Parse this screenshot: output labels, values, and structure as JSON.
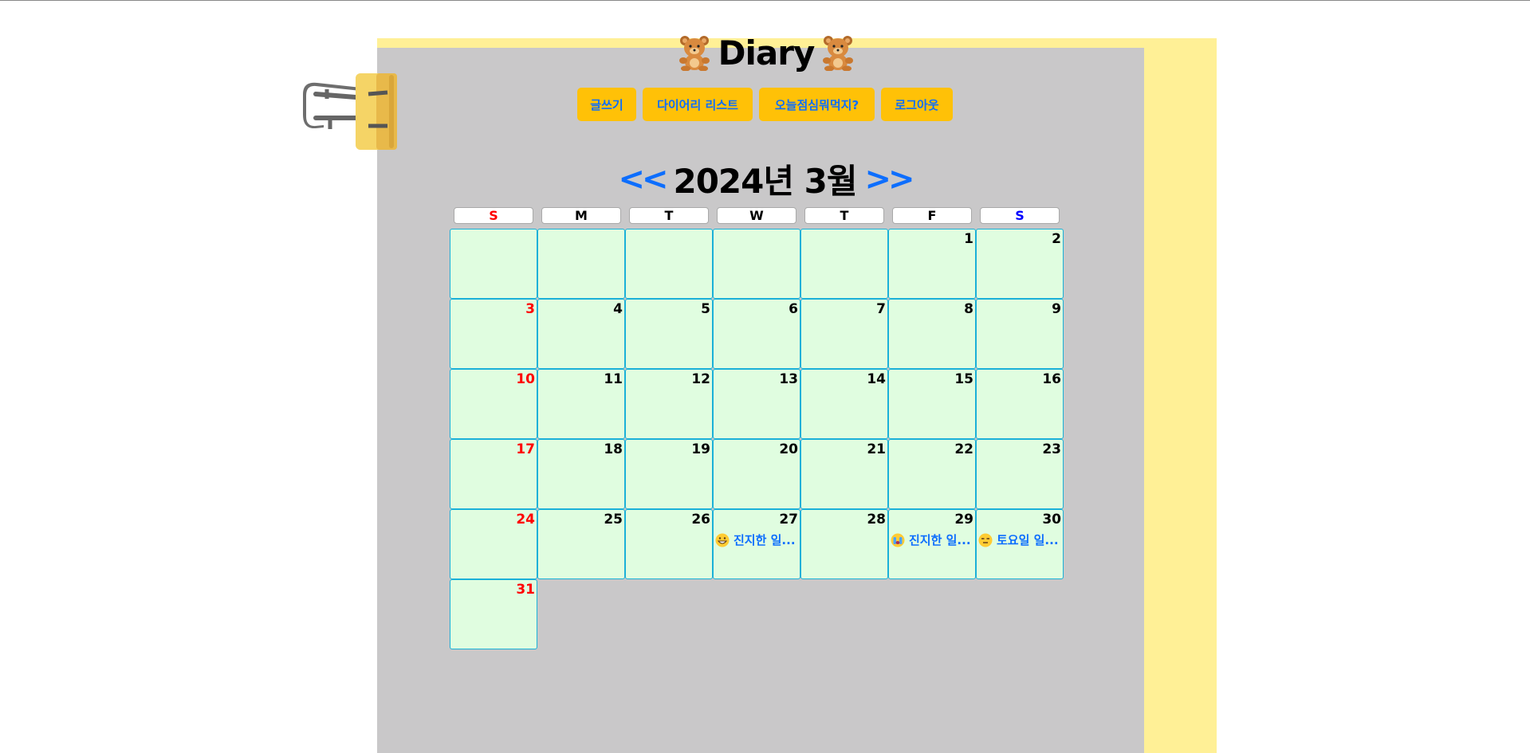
{
  "header": {
    "title": "Diary",
    "left_icon": "teddy-bear-icon",
    "right_icon": "teddy-bear-icon"
  },
  "nav": [
    {
      "label": "글쓰기"
    },
    {
      "label": "다이어리 리스트"
    },
    {
      "label": "오늘점심뭐먹지?"
    },
    {
      "label": "로그아웃"
    }
  ],
  "calendar": {
    "prev_label": "<<",
    "next_label": ">>",
    "month_title": "2024년 3월",
    "weekdays": [
      "S",
      "M",
      "T",
      "W",
      "T",
      "F",
      "S"
    ],
    "first_weekday_index": 5,
    "days_in_month": 31,
    "entries": [
      {
        "day": 27,
        "icon": "grinning-face-icon",
        "title": "진지한 일..."
      },
      {
        "day": 29,
        "icon": "crying-face-icon",
        "title": "진지한 일..."
      },
      {
        "day": 30,
        "icon": "expressionless-face-icon",
        "title": "토요일 일..."
      }
    ]
  },
  "colors": {
    "accent_button": "#ffc107",
    "link_blue": "#0d6efd",
    "sunday_red": "#ff0000",
    "saturday_blue": "#0000ff",
    "cell_bg": "#e0fde0",
    "paper_gray": "#c9c8c9",
    "paper_yellow": "#fff096"
  }
}
